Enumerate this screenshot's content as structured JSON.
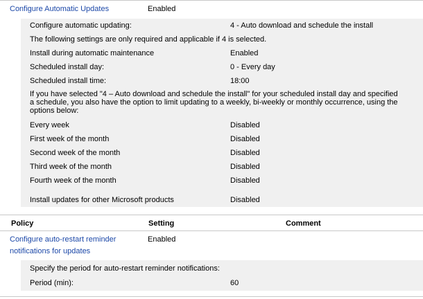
{
  "top_policy": {
    "name": "Configure Automatic Updates",
    "state": "Enabled"
  },
  "top_settings": [
    {
      "label": "Configure automatic updating:",
      "value": "4 - Auto download and schedule the install"
    },
    {
      "label": "The following settings are only required and applicable if 4 is selected.",
      "value": ""
    },
    {
      "label": "Install during automatic maintenance",
      "value": "Enabled"
    },
    {
      "label": "Scheduled install day:",
      "value": "0 - Every day"
    },
    {
      "label": "Scheduled install time:",
      "value": "18:00"
    }
  ],
  "paragraph": "If you have selected \"4 – Auto download and schedule the install\" for your scheduled install day and specified a schedule, you also have the option to limit updating to a weekly, bi-weekly or monthly occurrence, using the options below:",
  "week_settings": [
    {
      "label": "Every week",
      "value": "Disabled"
    },
    {
      "label": "First week of the month",
      "value": "Disabled"
    },
    {
      "label": "Second week of the month",
      "value": "Disabled"
    },
    {
      "label": "Third week of the month",
      "value": "Disabled"
    },
    {
      "label": "Fourth week of the month",
      "value": "Disabled"
    }
  ],
  "other_products": {
    "label": "Install updates for other Microsoft products",
    "value": "Disabled"
  },
  "table_header": {
    "policy": "Policy",
    "setting": "Setting",
    "comment": "Comment"
  },
  "restart_policy": {
    "name_line1": "Configure auto-restart reminder",
    "name_line2": "notifications for updates",
    "state": "Enabled"
  },
  "restart_settings": {
    "description": "Specify the period for auto-restart reminder notifications:",
    "period_label": "Period (min):",
    "period_value": "60"
  }
}
